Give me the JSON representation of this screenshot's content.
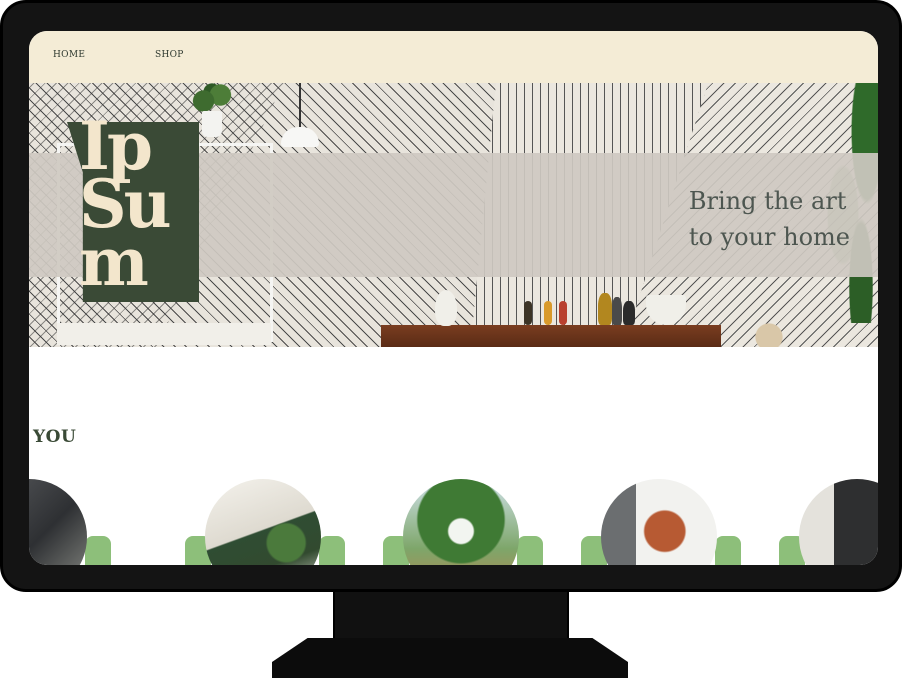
{
  "nav": {
    "home_label": "HOME",
    "shop_label": "SHOP"
  },
  "hero": {
    "logo_text": "Ip Su m",
    "title_line1": "Bring the art",
    "title_line2": "to your home"
  },
  "section": {
    "heading": "YOU"
  },
  "categories": [
    {
      "icon": "armchair-photo"
    },
    {
      "icon": "sofa-photo"
    },
    {
      "icon": "garden-arch-photo"
    },
    {
      "icon": "butterfly-chair-photo"
    },
    {
      "icon": "cabinet-photo"
    }
  ],
  "colors": {
    "nav_bg": "#f4ecd6",
    "logo_green": "#3a4a36",
    "logo_cream": "#f3e6cc",
    "accent_green": "#8dbf7a",
    "bezel": "#141414"
  }
}
